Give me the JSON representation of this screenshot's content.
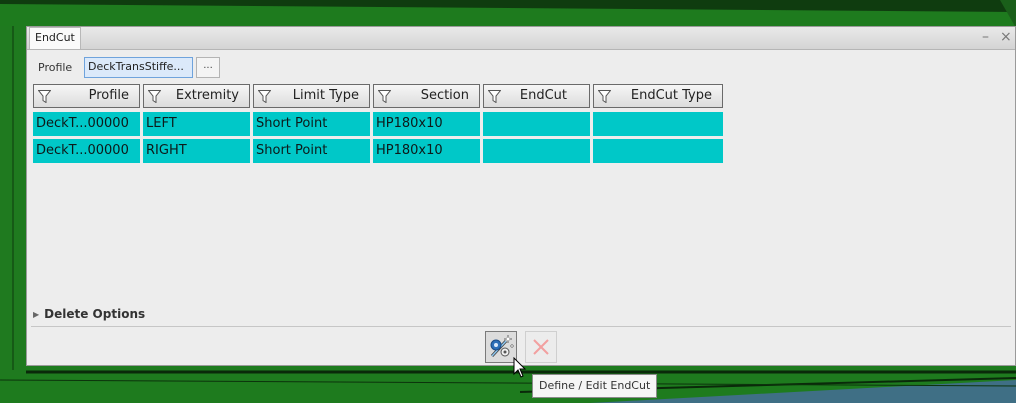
{
  "panel": {
    "tab_label": "EndCut",
    "minimize_glyph": "–",
    "close_glyph": "×"
  },
  "profile": {
    "label": "Profile",
    "value": "DeckTransStiffe...",
    "browse_label": "..."
  },
  "grid": {
    "columns": [
      "Profile",
      "Extremity",
      "Limit Type",
      "Section",
      "EndCut",
      "EndCut Type"
    ],
    "rows": [
      [
        "DeckT...00000",
        "LEFT",
        "Short Point",
        "HP180x10",
        "",
        ""
      ],
      [
        "DeckT...00000",
        "RIGHT",
        "Short Point",
        "HP180x10",
        "",
        ""
      ]
    ],
    "row_color": "#00c8c8"
  },
  "delete_options": {
    "label": "Delete Options"
  },
  "actions": {
    "define_icon": "wand-gear-icon",
    "cancel_icon": "close-icon"
  },
  "tooltip": {
    "text": "Define / Edit EndCut"
  },
  "colors": {
    "background": "#1d7a1d",
    "dark_overlay": "#113311",
    "blue_area": "#3f6f85",
    "selection": "#00c8c8"
  }
}
